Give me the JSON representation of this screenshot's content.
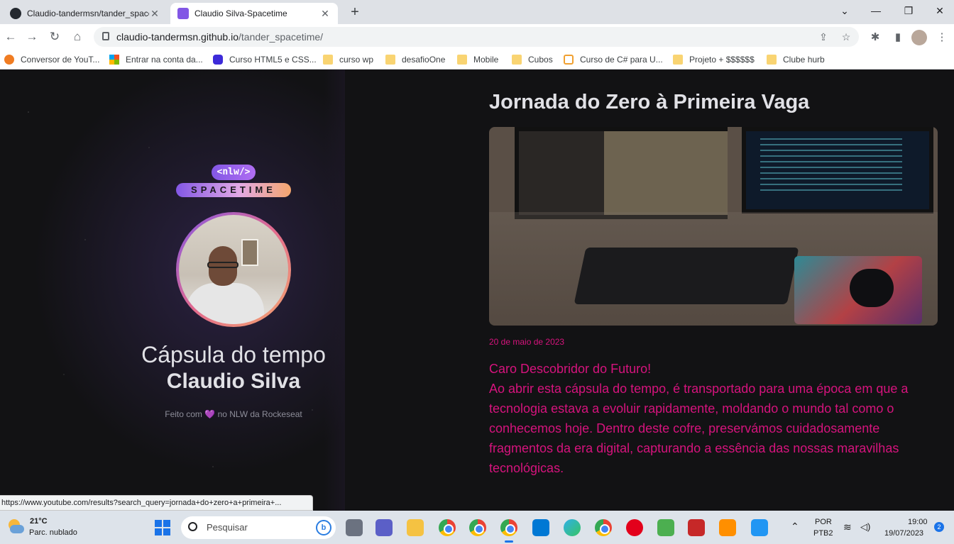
{
  "browser": {
    "tabs": [
      {
        "title": "Claudio-tandermsn/tander_spacetime",
        "favicon": "github-icon",
        "active": false
      },
      {
        "title": "Claudio Silva-Spacetime",
        "favicon": "nlw-icon",
        "active": true
      }
    ],
    "url_host": "claudio-tandermsn.github.io",
    "url_path": "/tander_spacetime/",
    "bookmarks": [
      {
        "label": "Conversor de YouT...",
        "icon": "bookmark-site-icon"
      },
      {
        "label": "Entrar na conta da...",
        "icon": "microsoft-icon"
      },
      {
        "label": "Curso HTML5 e CSS...",
        "icon": "play-icon"
      },
      {
        "label": "curso wp",
        "icon": "folder-icon"
      },
      {
        "label": "desafioOne",
        "icon": "folder-icon"
      },
      {
        "label": "Mobile",
        "icon": "folder-icon"
      },
      {
        "label": "Cubos",
        "icon": "folder-icon"
      },
      {
        "label": "Curso de C# para U...",
        "icon": "bookmark-site-icon"
      },
      {
        "label": "Projeto + $$$$$$",
        "icon": "folder-icon"
      },
      {
        "label": "Clube hurb",
        "icon": "folder-icon"
      }
    ],
    "status_url": "https://www.youtube.com/results?search_query=jornada+do+zero+a+primeira+..."
  },
  "sidebar": {
    "logo_top": "<nlw/>",
    "logo_bottom": "SPACETIME",
    "capsule_title": "Cápsula do tempo",
    "capsule_name": "Claudio Silva",
    "made_with_prefix": "Feito com",
    "made_with_heart": "💜",
    "made_with_suffix": "no NLW da Rockeseat"
  },
  "memory": {
    "title": "Jornada do Zero à Primeira Vaga",
    "date": "20 de maio de 2023",
    "greeting": "Caro Descobridor do Futuro!",
    "body": "Ao abrir esta cápsula do tempo, é transportado para uma época em que a tecnologia estava a evoluir rapidamente, moldando o mundo tal como o conhecemos hoje. Dentro deste cofre, preservámos cuidadosamente fragmentos da era digital, capturando a essência das nossas maravilhas tecnológicas."
  },
  "taskbar": {
    "temperature": "21°C",
    "weather": "Parc. nublado",
    "search_placeholder": "Pesquisar",
    "lang_top": "POR",
    "lang_bottom": "PTB2",
    "time": "19:00",
    "date": "19/07/2023",
    "notifications": "2"
  },
  "colors": {
    "page_bg": "#121214",
    "accent_pink": "#d6137d",
    "brand_purple": "#8257e5",
    "text_light": "#e1e1e6"
  }
}
